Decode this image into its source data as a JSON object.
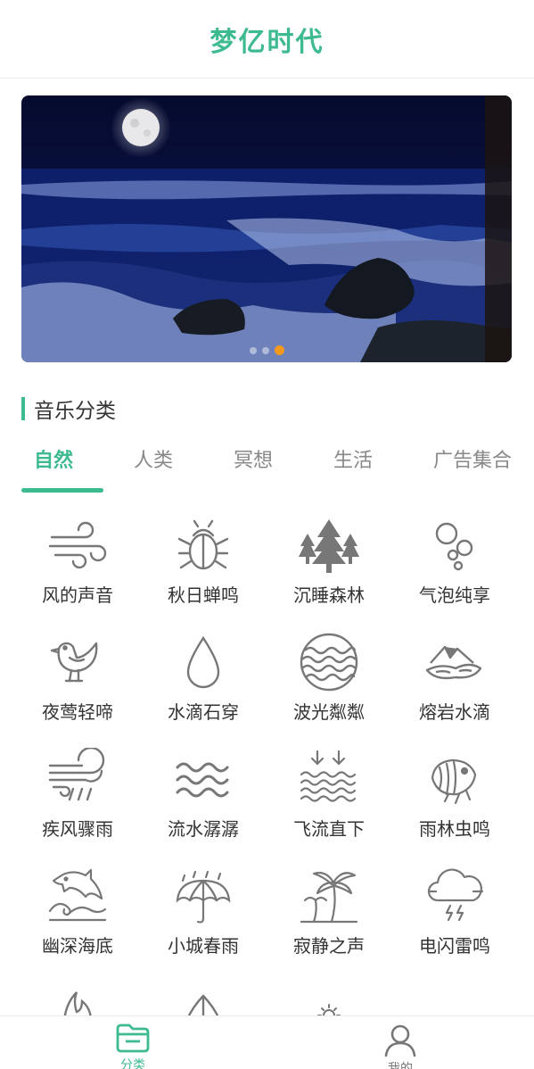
{
  "header": {
    "title": "梦亿时代"
  },
  "banner": {
    "slide_count": 3,
    "active_slide": 3
  },
  "section": {
    "title": "音乐分类"
  },
  "tabs": [
    {
      "label": "自然",
      "active": true
    },
    {
      "label": "人类",
      "active": false
    },
    {
      "label": "冥想",
      "active": false
    },
    {
      "label": "生活",
      "active": false
    },
    {
      "label": "广告集合",
      "active": false
    }
  ],
  "sounds": [
    {
      "label": "风的声音",
      "icon": "wind-icon"
    },
    {
      "label": "秋日蝉鸣",
      "icon": "cicada-icon"
    },
    {
      "label": "沉睡森林",
      "icon": "forest-icon"
    },
    {
      "label": "气泡纯享",
      "icon": "bubbles-icon"
    },
    {
      "label": "夜莺轻啼",
      "icon": "nightingale-icon"
    },
    {
      "label": "水滴石穿",
      "icon": "water-drop-icon"
    },
    {
      "label": "波光粼粼",
      "icon": "wavy-sphere-icon"
    },
    {
      "label": "熔岩水滴",
      "icon": "lava-icon"
    },
    {
      "label": "疾风骤雨",
      "icon": "wind-rain-icon"
    },
    {
      "label": "流水潺潺",
      "icon": "flowing-water-icon"
    },
    {
      "label": "飞流直下",
      "icon": "waterfall-icon"
    },
    {
      "label": "雨林虫鸣",
      "icon": "insect-icon"
    },
    {
      "label": "幽深海底",
      "icon": "dolphin-icon"
    },
    {
      "label": "小城春雨",
      "icon": "umbrella-icon"
    },
    {
      "label": "寂静之声",
      "icon": "palm-tree-icon"
    },
    {
      "label": "电闪雷鸣",
      "icon": "thunder-cloud-icon"
    },
    {
      "label": "",
      "icon": "fire-icon"
    },
    {
      "label": "",
      "icon": "leaf-icon"
    },
    {
      "label": "",
      "icon": "sun-icon"
    }
  ],
  "bottom_nav": [
    {
      "label": "分类",
      "icon": "folder-icon",
      "active": true
    },
    {
      "label": "我的",
      "icon": "user-icon",
      "active": false
    }
  ],
  "colors": {
    "accent": "#3dbb8f",
    "indicator_active": "#f39a1e",
    "icon_stroke": "#777777"
  }
}
